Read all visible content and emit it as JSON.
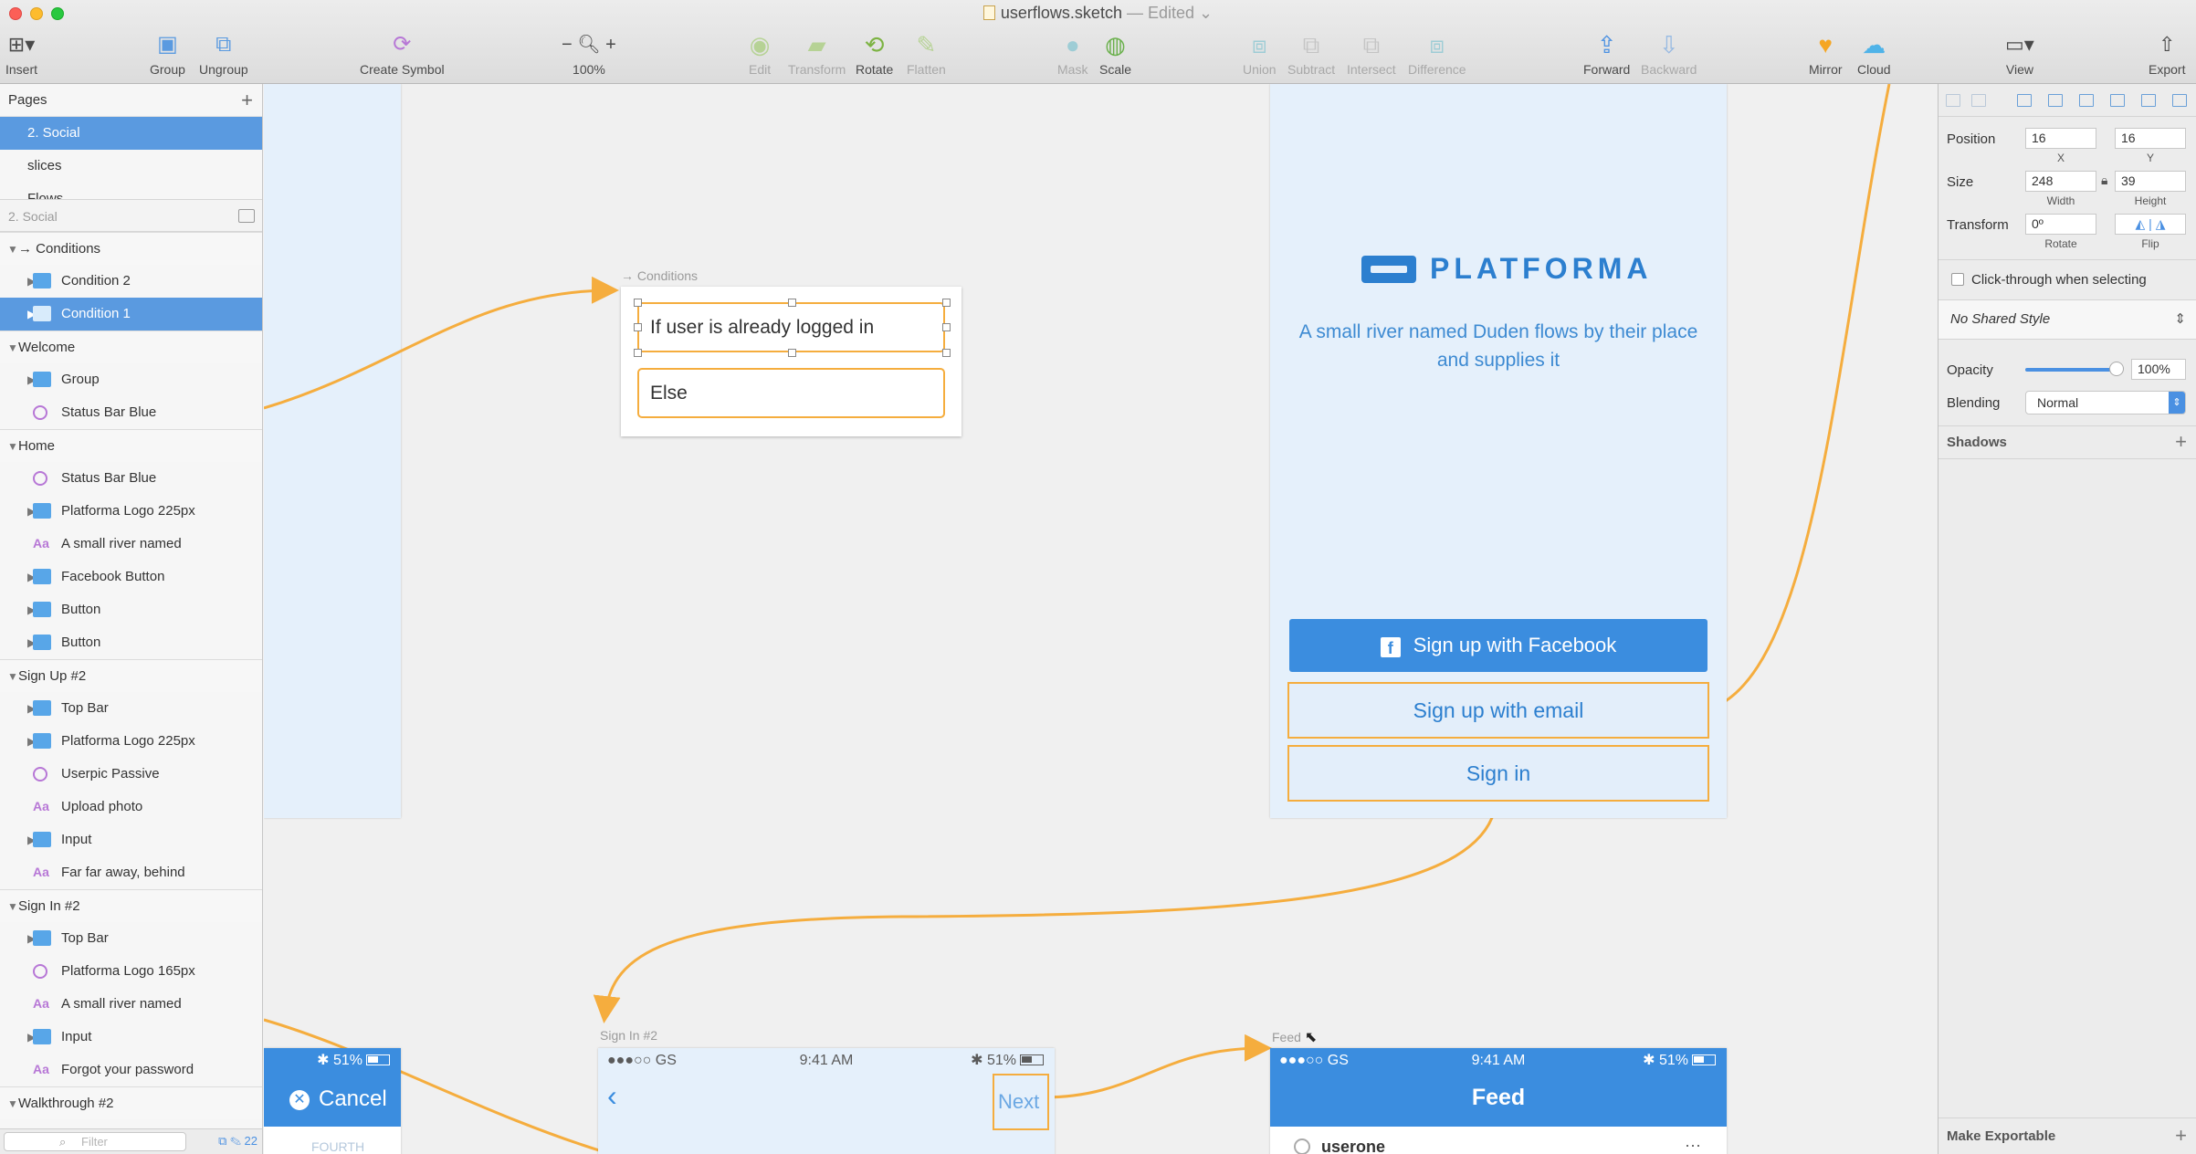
{
  "window": {
    "title": "userflows.sketch",
    "edited": " — Edited ⌄"
  },
  "toolbar": {
    "insert": "Insert",
    "group": "Group",
    "ungroup": "Ungroup",
    "create_symbol": "Create Symbol",
    "zoom": "100%",
    "edit": "Edit",
    "transform": "Transform",
    "rotate": "Rotate",
    "flatten": "Flatten",
    "mask": "Mask",
    "scale": "Scale",
    "union": "Union",
    "subtract": "Subtract",
    "intersect": "Intersect",
    "difference": "Difference",
    "forward": "Forward",
    "backward": "Backward",
    "mirror": "Mirror",
    "cloud": "Cloud",
    "view": "View",
    "export": "Export"
  },
  "pages": {
    "header": "Pages",
    "items": [
      "2. Social",
      "slices",
      "Flows"
    ]
  },
  "layers": {
    "header": "2. Social",
    "items": [
      {
        "name": "→ Conditions",
        "type": "artboard"
      },
      {
        "name": "Condition 2",
        "type": "folder"
      },
      {
        "name": "Condition 1",
        "type": "folder"
      },
      {
        "name": "Welcome",
        "type": "artboard"
      },
      {
        "name": "Group",
        "type": "folder"
      },
      {
        "name": "Status Bar Blue",
        "type": "symbol"
      },
      {
        "name": "Home",
        "type": "artboard"
      },
      {
        "name": "Status Bar Blue",
        "type": "symbol"
      },
      {
        "name": "Platforma Logo 225px",
        "type": "folder"
      },
      {
        "name": "A small river named",
        "type": "text"
      },
      {
        "name": "Facebook Button",
        "type": "folder"
      },
      {
        "name": "Button",
        "type": "folder"
      },
      {
        "name": "Button",
        "type": "folder"
      },
      {
        "name": "Sign Up #2",
        "type": "artboard"
      },
      {
        "name": "Top Bar",
        "type": "folder"
      },
      {
        "name": "Platforma Logo 225px",
        "type": "folder"
      },
      {
        "name": "Userpic Passive",
        "type": "symbol"
      },
      {
        "name": "Upload photo",
        "type": "text"
      },
      {
        "name": "Input",
        "type": "folder"
      },
      {
        "name": "Far far away, behind",
        "type": "text"
      },
      {
        "name": "Sign In #2",
        "type": "artboard"
      },
      {
        "name": "Top Bar",
        "type": "folder"
      },
      {
        "name": "Platforma Logo 165px",
        "type": "symbol"
      },
      {
        "name": "A small river named",
        "type": "text"
      },
      {
        "name": "Input",
        "type": "folder"
      },
      {
        "name": "Forgot your password",
        "type": "text"
      },
      {
        "name": "Walkthrough #2",
        "type": "artboard"
      }
    ],
    "filter_placeholder": "Filter",
    "filter_count": "22"
  },
  "canvas": {
    "conditions_label": "→ Conditions",
    "condition_1": "If user is already logged in",
    "condition_2": "Else",
    "logo_text": "PLATFORMA",
    "tagline": "A small river named Duden flows by their place and supplies it",
    "fb_button": "Sign up with Facebook",
    "email_button": "Sign up with email",
    "signin_button": "Sign in",
    "signin_label": "Sign In #2",
    "feed_label": "Feed",
    "cancel": "Cancel",
    "walkthrough_text": "FOURTH",
    "status_battery": "51%",
    "status_carrier": "●●●○○ GS",
    "status_time": "9:41 AM",
    "next": "Next",
    "feed_title": "Feed",
    "feed_user": "userone"
  },
  "inspector": {
    "position_label": "Position",
    "x": "16",
    "y": "16",
    "x_sub": "X",
    "y_sub": "Y",
    "size_label": "Size",
    "width": "248",
    "height": "39",
    "width_sub": "Width",
    "height_sub": "Height",
    "transform_label": "Transform",
    "rotate": "0º",
    "rotate_sub": "Rotate",
    "flip_sub": "Flip",
    "click_through": "Click-through when selecting",
    "shared_style": "No Shared Style",
    "opacity_label": "Opacity",
    "opacity": "100%",
    "blending_label": "Blending",
    "blending": "Normal",
    "shadows": "Shadows",
    "make_exportable": "Make Exportable"
  },
  "colors": {
    "accent": "#5a9ae0",
    "flow": "#f5ad3e",
    "brand": "#2c7fcf"
  }
}
